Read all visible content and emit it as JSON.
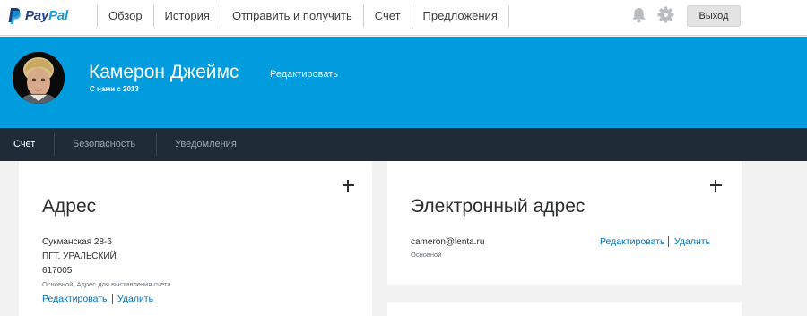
{
  "brand": {
    "logo_pay": "Pay",
    "logo_pal": "Pal",
    "colors": {
      "dark": "#253b80",
      "light": "#179bd7"
    }
  },
  "topnav": {
    "items": [
      "Обзор",
      "История",
      "Отправить и получить",
      "Счет",
      "Предложения"
    ],
    "logout_label": "Выход",
    "icons": [
      "bell-icon",
      "gear-icon"
    ]
  },
  "profile": {
    "name": "Камерон Джеймс",
    "edit_label": "Редактировать",
    "since": "С нами с 2013",
    "header_color": "#009cde"
  },
  "tabs": {
    "items": [
      "Счет",
      "Безопасность",
      "Уведомления"
    ],
    "active": "Счет"
  },
  "address_card": {
    "title": "Адрес",
    "lines": [
      "Сукманская 28-6",
      "ПГТ. УРАЛЬСКИЙ",
      "617005"
    ],
    "note": "Основной, Адрес для выставления счета",
    "edit_label": "Редактировать",
    "delete_label": "Удалить"
  },
  "email_card": {
    "title": "Электронный адрес",
    "email": "cameron@lenta.ru",
    "note": "Основной",
    "edit_label": "Редактировать",
    "delete_label": "Удалить"
  }
}
